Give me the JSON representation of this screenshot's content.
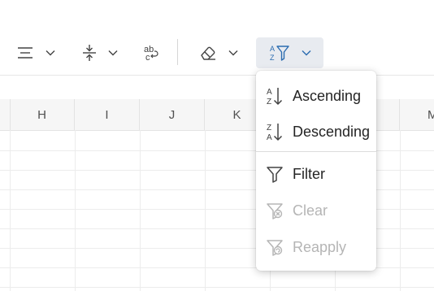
{
  "toolbar": {
    "buttons": [
      {
        "name": "align-icon",
        "has_dropdown": true
      },
      {
        "name": "vertical-align-icon",
        "has_dropdown": true
      },
      {
        "name": "wrap-text-icon",
        "has_dropdown": false
      },
      {
        "name": "eraser-icon",
        "has_dropdown": true
      },
      {
        "name": "sort-filter-icon",
        "has_dropdown": true,
        "active": true
      }
    ],
    "accent_color": "#2b6cb0"
  },
  "grid": {
    "columns": [
      "H",
      "I",
      "J",
      "K",
      "",
      "M"
    ]
  },
  "menu": {
    "items": [
      {
        "label": "Ascending",
        "icon": "sort-ascending-icon",
        "enabled": true
      },
      {
        "label": "Descending",
        "icon": "sort-descending-icon",
        "enabled": true
      },
      {
        "label": "Filter",
        "icon": "filter-icon",
        "enabled": true
      },
      {
        "label": "Clear",
        "icon": "clear-filter-icon",
        "enabled": false
      },
      {
        "label": "Reapply",
        "icon": "reapply-filter-icon",
        "enabled": false
      }
    ]
  }
}
